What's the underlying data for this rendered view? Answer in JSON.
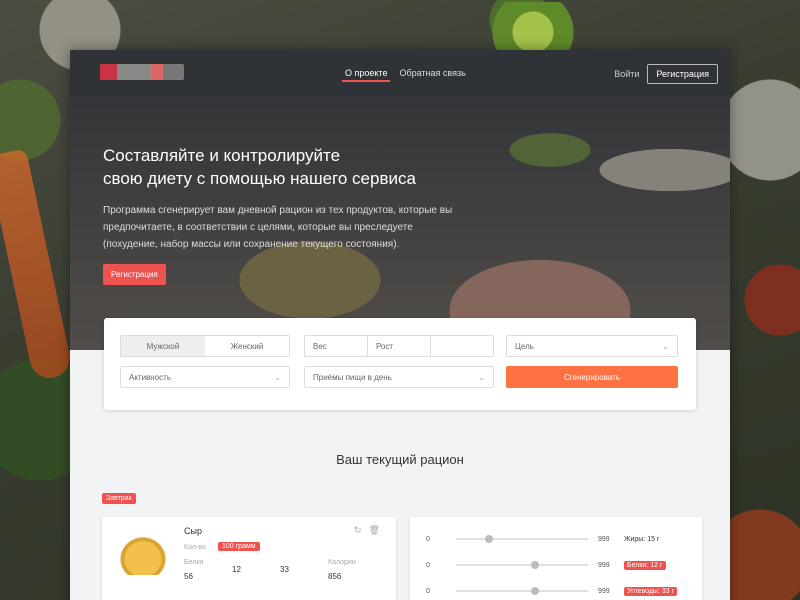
{
  "header": {
    "nav": [
      "О проекте",
      "Обратная связь"
    ],
    "login": "Войти",
    "register": "Регистрация"
  },
  "hero": {
    "title_line1": "Составляйте и контролируйте",
    "title_line2": "свою диету с помощью нашего сервиса",
    "description": "Программа сгенерирует вам дневной рацион из тех продуктов, которые вы предпочитаете, в соответствии с целями, которые вы преследуете (похудение, набор массы или сохранение текущего состояния).",
    "cta": "Регистрация"
  },
  "filter": {
    "gender_male": "Мужской",
    "gender_female": "Женский",
    "height": "Рост",
    "weight": "Вес",
    "goal": "Цель",
    "activity": "Активность",
    "meals": "Приёмы пищи в день",
    "generate": "Сгенерировать"
  },
  "plan": {
    "title": "Ваш текущий рацион",
    "day": "Завтрак"
  },
  "food": {
    "name": "Сыр",
    "qty_label": "Кол-во",
    "qty_value": "100 грамм",
    "macros": [
      {
        "label": "Белки",
        "value": "56"
      },
      {
        "label": "",
        "value": "12"
      },
      {
        "label": "",
        "value": "33"
      },
      {
        "label": "Калории",
        "value": "856"
      }
    ]
  },
  "sliders": [
    {
      "min": "0",
      "max": "999",
      "result": "Жиры: 15 г",
      "pos": 0.25,
      "tag": false
    },
    {
      "min": "0",
      "max": "999",
      "result": "Белки: 12 г",
      "pos": 0.6,
      "tag": true
    },
    {
      "min": "0",
      "max": "999",
      "result": "Углеводы: 33 г",
      "pos": 0.6,
      "tag": true
    }
  ],
  "colors": {
    "accent": "#ef5350",
    "generate": "#ff7043",
    "nav_bg": "#2f3338"
  }
}
